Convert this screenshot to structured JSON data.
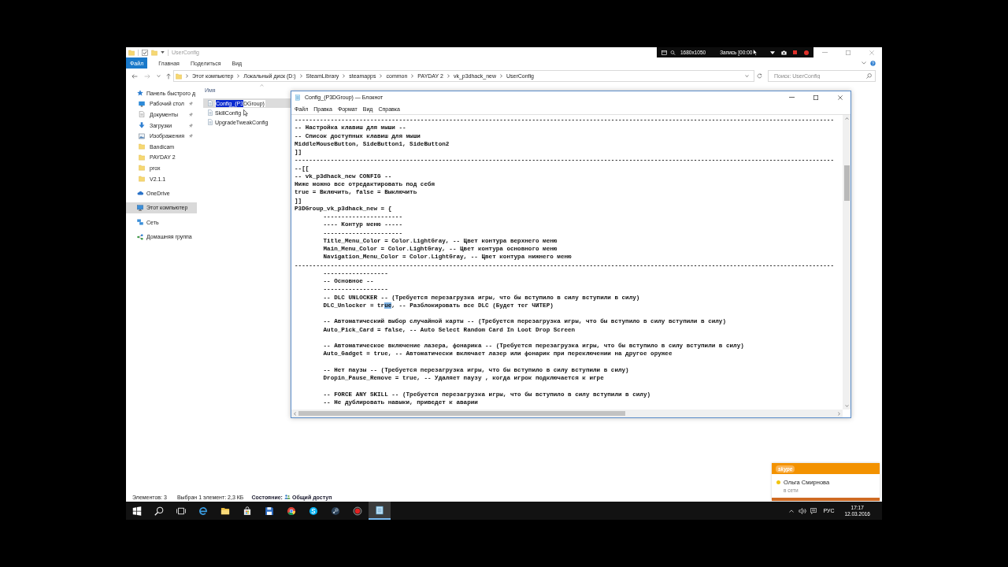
{
  "explorer": {
    "title": "UserConfig",
    "ribbon_tabs": [
      {
        "label": "Файл",
        "kind": "menu"
      },
      {
        "label": "Главная",
        "kind": "tab"
      },
      {
        "label": "Поделиться",
        "kind": "tab"
      },
      {
        "label": "Вид",
        "kind": "tab"
      }
    ],
    "breadcrumb": [
      "Этот компьютер",
      "Локальный диск (D:)",
      "SteamLibrary",
      "steamapps",
      "common",
      "PAYDAY 2",
      "vk_p3dhack_new",
      "UserConfig"
    ],
    "search": {
      "placeholder": "Поиск: UserConfig"
    },
    "navigation": [
      {
        "label": "Панель быстрого д",
        "kind": "star",
        "selected": false,
        "children": [
          {
            "label": "Рабочий стол",
            "kind": "desktop",
            "pinned": true,
            "selected": false
          },
          {
            "label": "Документы",
            "kind": "documents",
            "pinned": true,
            "selected": false
          },
          {
            "label": "Загрузки",
            "kind": "downloads",
            "pinned": true,
            "selected": false
          },
          {
            "label": "Изображения",
            "kind": "pictures",
            "pinned": true,
            "selected": false
          },
          {
            "label": "Bandicam",
            "kind": "folder",
            "pinned": false,
            "selected": false
          },
          {
            "label": "PAYDAY 2",
            "kind": "folder",
            "pinned": false,
            "selected": false
          },
          {
            "label": "prox",
            "kind": "folder",
            "pinned": false,
            "selected": false
          },
          {
            "label": "V2.1.1",
            "kind": "folder",
            "pinned": false,
            "selected": false
          }
        ]
      },
      {
        "label": "OneDrive",
        "kind": "cloud",
        "selected": false
      },
      {
        "label": "Этот компьютер",
        "kind": "computer",
        "selected": true
      },
      {
        "label": "Сеть",
        "kind": "network",
        "selected": false
      },
      {
        "label": "Домашняя группа",
        "kind": "homegroup",
        "selected": false
      }
    ],
    "column_header": "Имя",
    "files": [
      {
        "kind": "rename",
        "selected": true,
        "name_parts": [
          {
            "text": "Config_(P3",
            "selected": true
          },
          {
            "text": "DGroup)",
            "selected": false
          }
        ]
      },
      {
        "kind": "file",
        "selected": false,
        "name": "SkillConfig"
      },
      {
        "kind": "file",
        "selected": false,
        "name": "UpgradeTweakConfig"
      }
    ],
    "status_bar": {
      "item_count": "Элементов: 3",
      "selection": "Выбран 1 элемент: 2,3 КБ",
      "state_label": "Состояние:",
      "state_value": "Общий доступ"
    }
  },
  "recorder": {
    "resolution": "1680x1050",
    "status": "Запись [00:00"
  },
  "notepad": {
    "title": "Config_(P3DGroup) — Блокнот",
    "menu": [
      "Файл",
      "Правка",
      "Формат",
      "Вид",
      "Справка"
    ],
    "lines": [
      {
        "kind": "text",
        "text": "------------------------------------------------------------------------------------------------------------------------------------------------------"
      },
      {
        "kind": "text",
        "text": "-- Настройка клавиш для мыши --"
      },
      {
        "kind": "text",
        "text": "-- Список доступных клавиш для мыши"
      },
      {
        "kind": "text",
        "text": "MiddleMouseButton, SideButton1, SideButton2"
      },
      {
        "kind": "text",
        "text": "]]"
      },
      {
        "kind": "text",
        "text": "------------------------------------------------------------------------------------------------------------------------------------------------------"
      },
      {
        "kind": "text",
        "text": "--[["
      },
      {
        "kind": "text",
        "text": "-- vk_p3dhack_new CONFIG --"
      },
      {
        "kind": "text",
        "text": "Ниже можно все отредактировать под себя"
      },
      {
        "kind": "text",
        "text": "true = Включить, false = Выключить"
      },
      {
        "kind": "text",
        "text": "]]"
      },
      {
        "kind": "text",
        "text": "P3DGroup_vk_p3dhack_new = {"
      },
      {
        "kind": "text",
        "text": "\t----------------------"
      },
      {
        "kind": "text",
        "text": "\t---- Контур меню -----"
      },
      {
        "kind": "text",
        "text": "\t----------------------"
      },
      {
        "kind": "text",
        "text": "\tTitle_Menu_Color = Color.LightGray, -- Цвет контура верхнего меню"
      },
      {
        "kind": "text",
        "text": "\tMain_Menu_Color = Color.LightGray, -- Цвет контура основного меню"
      },
      {
        "kind": "text",
        "text": "\tNavigation_Menu_Color = Color.LightGray, -- Цвет контура нижнего меню"
      },
      {
        "kind": "text",
        "text": "------------------------------------------------------------------------------------------------------------------------------------------------------"
      },
      {
        "kind": "text",
        "text": "\t------------------"
      },
      {
        "kind": "text",
        "text": "\t-- Основное --"
      },
      {
        "kind": "text",
        "text": "\t------------------"
      },
      {
        "kind": "text",
        "text": "\t-- DLC UNLOCKER -- (Требуется перезагрузка игры, что бы вступило в силу вступили в силу)"
      },
      {
        "kind": "selection",
        "parts": [
          {
            "text": "\tDLC_Unlocker = tr",
            "selected": false
          },
          {
            "text": "ue",
            "selected": true
          },
          {
            "text": ", -- Разблокировать все DLC (Будет тег ЧИТЕР)",
            "selected": false
          }
        ]
      },
      {
        "kind": "blank"
      },
      {
        "kind": "text",
        "text": "\t-- Автоматический выбор случайной карты -- (Требуется перезагрузка игры, что бы вступило в силу вступили в силу)"
      },
      {
        "kind": "text",
        "text": "\tAuto_Pick_Card = false, -- Auto Select Random Card In Loot Drop Screen"
      },
      {
        "kind": "blank"
      },
      {
        "kind": "text",
        "text": "\t-- Автоматическое включение лазера, фонарика -- (Требуется перезагрузка игры, что бы вступило в силу вступили в силу)"
      },
      {
        "kind": "text",
        "text": "\tAuto_Gadget = true, -- Автоматически включает лазер или фонарик при переключении на другое оружее"
      },
      {
        "kind": "blank"
      },
      {
        "kind": "text",
        "text": "\t-- Нет паузы -- (Требуется перезагрузка игры, что бы вступило в силу вступили в силу)"
      },
      {
        "kind": "text",
        "text": "\tDropin_Pause_Remove = true, -- Удаляет паузу , когда игрок подключается к игре"
      },
      {
        "kind": "blank"
      },
      {
        "kind": "text",
        "text": "\t-- FORCE ANY SKILL -- (Требуется перезагрузка игры, что бы вступило в силу вступили в силу)"
      },
      {
        "kind": "text",
        "text": "\t-- Не дублировать навыки, приведет к аварии"
      }
    ]
  },
  "notification": {
    "app": "skype",
    "contact": "Ольга Смирнова",
    "status": "в сети"
  },
  "taskbar": {
    "apps": [
      {
        "kind": "edge",
        "active": false
      },
      {
        "kind": "explorer",
        "active": false
      },
      {
        "kind": "store",
        "active": false
      },
      {
        "kind": "save",
        "active": false
      },
      {
        "kind": "chrome",
        "active": false
      },
      {
        "kind": "skype",
        "active": false
      },
      {
        "kind": "steam",
        "active": false
      },
      {
        "kind": "record",
        "active": false
      },
      {
        "kind": "notepad",
        "active": true
      }
    ],
    "language": "РУС",
    "time": "17:17",
    "date": "12.03.2016"
  }
}
